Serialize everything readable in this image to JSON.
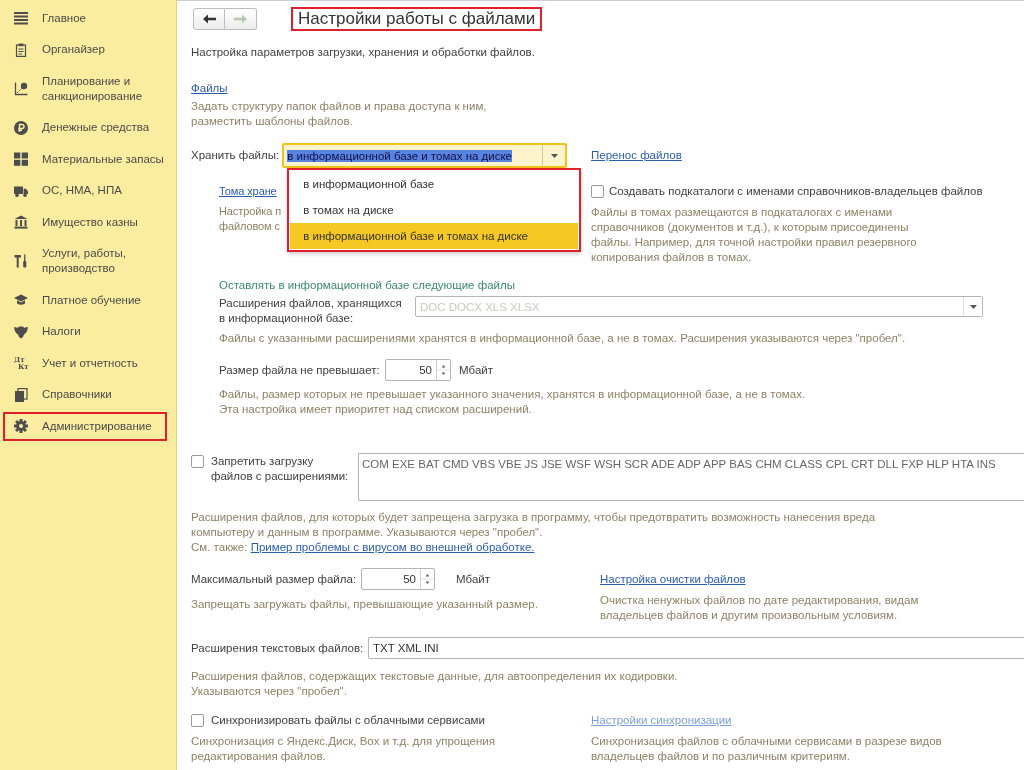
{
  "sidebar": {
    "items": [
      {
        "label": "Главное",
        "highlighted": false
      },
      {
        "label": "Органайзер",
        "highlighted": false
      },
      {
        "label": "Планирование и санкционирование",
        "highlighted": false
      },
      {
        "label": "Денежные средства",
        "highlighted": false
      },
      {
        "label": "Материальные запасы",
        "highlighted": false
      },
      {
        "label": "ОС, НМА, НПА",
        "highlighted": false
      },
      {
        "label": "Имущество казны",
        "highlighted": false
      },
      {
        "label": "Услуги, работы, производство",
        "highlighted": false
      },
      {
        "label": "Платное обучение",
        "highlighted": false
      },
      {
        "label": "Налоги",
        "highlighted": false
      },
      {
        "label": "Учет и отчетность",
        "highlighted": false,
        "icon_text": [
          "Дт",
          "Кт"
        ]
      },
      {
        "label": "Справочники",
        "highlighted": false
      },
      {
        "label": "Администрирование",
        "highlighted": true
      }
    ]
  },
  "nav": {
    "buttons": [
      {
        "kind": "back",
        "disabled": false
      },
      {
        "kind": "forward",
        "disabled": true
      }
    ]
  },
  "title": {
    "text": "Настройки работы с файлами",
    "highlighted": true
  },
  "description": "Настройка параметров загрузки, хранения и обработки файлов.",
  "files": {
    "link": "Файлы",
    "hint_lines": [
      "Задать структуру папок файлов и права доступа к ним,",
      "разместить шаблоны файлов."
    ]
  },
  "storage": {
    "label": "Хранить файлы:",
    "value": "в информационной базе и томах на диске",
    "focused": true,
    "expanded": true,
    "list_highlighted": true,
    "options": [
      {
        "label": "в информационной базе",
        "selected": false
      },
      {
        "label": "в томах на диске",
        "selected": false
      },
      {
        "label": "в информационной базе и томах на диске",
        "selected": true
      }
    ],
    "transfer_link": "Перенос файлов"
  },
  "volumes": {
    "link": "Тома хране",
    "hint_lines": [
      "Настройка п",
      "файловом с"
    ]
  },
  "subfolders": {
    "label": "Создавать подкаталоги с именами справочников-владельцев файлов",
    "checked": false,
    "hint_lines": [
      "Файлы в томах размещаются в подкаталогах с именами",
      "справочников (документов и т.д.), к которым присоединены",
      "файлы. Например, для точной настройки правил резервного",
      "копирования файлов в томах."
    ]
  },
  "keep_in_base": {
    "heading": "Оставлять в информационной базе следующие файлы",
    "extensions": {
      "label_lines": [
        "Расширения файлов, хранящихся",
        "в информационной базе:"
      ],
      "placeholder": "DOC DOCX XLS XLSX",
      "hint": "Файлы с указанными расширениями хранятся в информационной базе, а не в томах. Расширения указываются через \"пробел\"."
    },
    "size": {
      "label": "Размер файла не превышает:",
      "value": "50",
      "unit": "Мбайт",
      "hint_lines": [
        "Файлы, размер которых не превышает указанного значения, хранятся в информационной базе, а не в томах.",
        "Эта настройка имеет приоритет над списком расширений."
      ]
    }
  },
  "forbid_upload": {
    "label_lines": [
      "Запретить загрузку",
      "файлов с расширениями:"
    ],
    "checked": false,
    "value": "COM EXE BAT CMD VBS VBE JS JSE WSF WSH SCR ADE ADP APP BAS CHM CLASS CPL CRT DLL FXP HLP HTA INS",
    "hint_lines": [
      "Расширения файлов, для которых будет запрещена загрузка в программу, чтобы предотвратить возможность нанесения вреда",
      "компьютеру и данным в программе. Указываются через \"пробел\"."
    ],
    "see_also": "См. также:",
    "see_also_link": "Пример проблемы с вирусом во внешней обработке."
  },
  "max_size": {
    "label": "Максимальный размер файла:",
    "value": "50",
    "unit": "Мбайт",
    "hint": "Запрещать загружать файлы, превышающие указанный размер."
  },
  "cleanup": {
    "link": "Настройка очистки файлов",
    "hint_lines": [
      "Очистка ненужных файлов по дате редактирования, видам",
      "владельцев файлов и другим произвольным условиям."
    ]
  },
  "text_extensions": {
    "label": "Расширения текстовых файлов:",
    "value": "TXT XML INI",
    "hint_lines": [
      "Расширения файлов, содержащих текстовые данные, для автоопределения их кодировки.",
      "Указываются через \"пробел\"."
    ]
  },
  "sync": {
    "label": "Синхронизировать файлы с облачными сервисами",
    "checked": false,
    "hint_lines": [
      "Синхронизация с Яндекс.Диск, Box и т.д. для упрощения",
      "редактирования файлов."
    ]
  },
  "sync_settings": {
    "link": "Настройки синхронизации",
    "disabled": true,
    "hint_lines": [
      "Синхронизация файлов с облачными сервисами в разрезе видов",
      "владельцев файлов и по различным критериям."
    ]
  }
}
